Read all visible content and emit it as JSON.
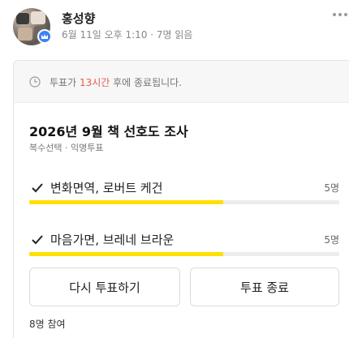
{
  "post": {
    "author": "홍성향",
    "meta": "6월 11일 오후 1:10 · 7명 읽음"
  },
  "poll": {
    "notice_prefix": "투표가 ",
    "notice_highlight": "13시간",
    "notice_suffix": " 후에 종료됩니다.",
    "title": "2026년 9월 책 선호도 조사",
    "subtitle": "복수선택 · 익명투표",
    "options": [
      {
        "label": "변화면역, 로버트 케건",
        "count": "5명",
        "fraction": 0.625
      },
      {
        "label": "마음가면, 브레네 브라운",
        "count": "5명",
        "fraction": 0.625
      }
    ],
    "revote_label": "다시 투표하기",
    "end_label": "투표 종료",
    "participants": "8명 참여"
  },
  "colors": {
    "accent": "#ffdf00",
    "highlight": "#e85d4a",
    "badge": "#3b82f6"
  },
  "icons": {
    "badge": "crown-icon",
    "notice": "clock-icon",
    "option": "check-icon",
    "menu": "more-dots-icon"
  }
}
